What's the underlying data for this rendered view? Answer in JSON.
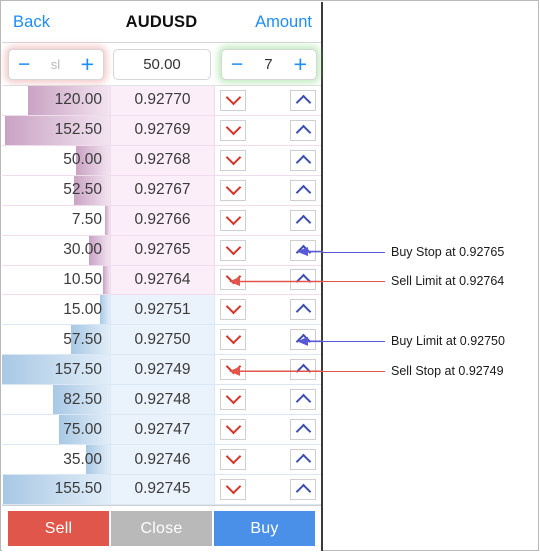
{
  "nav": {
    "back_label": "Back",
    "title": "AUDUSD",
    "amount_label": "Amount"
  },
  "controls": {
    "sl_stepper": {
      "minus": "−",
      "value": "sl",
      "plus": "+"
    },
    "price_value": "50.00",
    "qty_stepper": {
      "minus": "−",
      "value": "7",
      "plus": "+"
    }
  },
  "depth": {
    "max_volume": 157.5,
    "rows": [
      {
        "volume": "120.00",
        "vol_num": 120.0,
        "price": "0.92770",
        "side": "ask"
      },
      {
        "volume": "152.50",
        "vol_num": 152.5,
        "price": "0.92769",
        "side": "ask"
      },
      {
        "volume": "50.00",
        "vol_num": 50.0,
        "price": "0.92768",
        "side": "ask"
      },
      {
        "volume": "52.50",
        "vol_num": 52.5,
        "price": "0.92767",
        "side": "ask"
      },
      {
        "volume": "7.50",
        "vol_num": 7.5,
        "price": "0.92766",
        "side": "ask"
      },
      {
        "volume": "30.00",
        "vol_num": 30.0,
        "price": "0.92765",
        "side": "ask"
      },
      {
        "volume": "10.50",
        "vol_num": 10.5,
        "price": "0.92764",
        "side": "ask"
      },
      {
        "volume": "15.00",
        "vol_num": 15.0,
        "price": "0.92751",
        "side": "bid"
      },
      {
        "volume": "57.50",
        "vol_num": 57.5,
        "price": "0.92750",
        "side": "bid"
      },
      {
        "volume": "157.50",
        "vol_num": 157.5,
        "price": "0.92749",
        "side": "bid"
      },
      {
        "volume": "82.50",
        "vol_num": 82.5,
        "price": "0.92748",
        "side": "bid"
      },
      {
        "volume": "75.00",
        "vol_num": 75.0,
        "price": "0.92747",
        "side": "bid"
      },
      {
        "volume": "35.00",
        "vol_num": 35.0,
        "price": "0.92746",
        "side": "bid"
      },
      {
        "volume": "155.50",
        "vol_num": 155.5,
        "price": "0.92745",
        "side": "bid"
      }
    ]
  },
  "actions": {
    "sell_label": "Sell",
    "close_label": "Close",
    "buy_label": "Buy"
  },
  "annotations": [
    {
      "text": "Buy Stop at 0.92765",
      "color": "blue",
      "row_index": 5,
      "target": "up"
    },
    {
      "text": "Sell Limit at 0.92764",
      "color": "red",
      "row_index": 6,
      "target": "down"
    },
    {
      "text": "Buy Limit at 0.92750",
      "color": "blue",
      "row_index": 8,
      "target": "up"
    },
    {
      "text": "Sell Stop at 0.92749",
      "color": "red",
      "row_index": 9,
      "target": "down"
    }
  ],
  "colors": {
    "sell": "#e0564a",
    "buy": "#4a90e8",
    "close": "#b9b9b9",
    "link": "#1d8cff",
    "ask_tint": "#fbeef8",
    "bid_tint": "#eaf2fb",
    "annotation_blue": "#5a5ad8",
    "annotation_red": "#e2554a"
  }
}
